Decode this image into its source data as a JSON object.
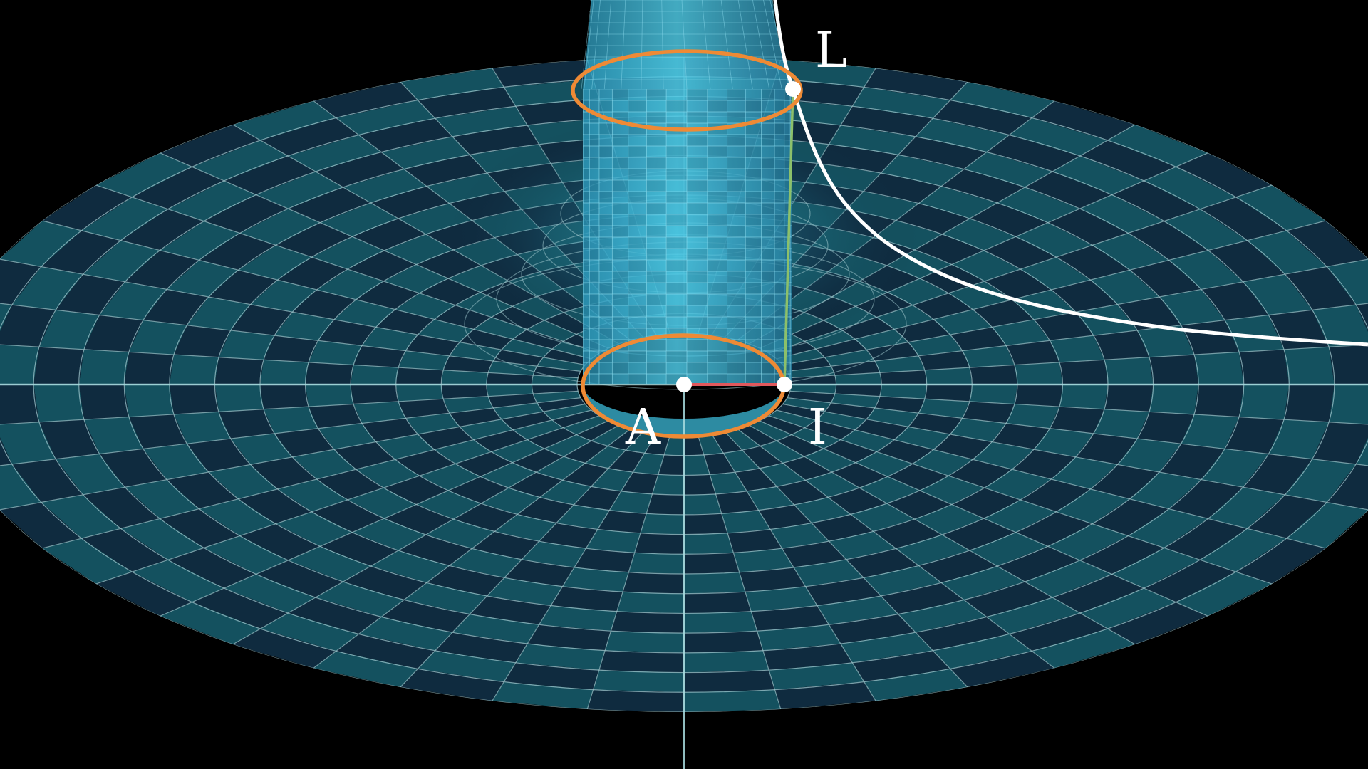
{
  "labels": {
    "top": "L",
    "bottom_left": "A",
    "bottom_right": "I"
  },
  "colors": {
    "background": "#000000",
    "disk_dark": "#0f2b3f",
    "disk_light": "#14515f",
    "grid_line": "#9fc6cc",
    "axis": "#a9dde0",
    "tube_light": "#3fc4df",
    "tube_dark": "#2a8fb0",
    "ring": "#ee8a35",
    "curve": "#ffffff",
    "radius_segment": "#e0585c",
    "vertical_segment": "#8cc06a",
    "point": "#ffffff"
  },
  "grid": {
    "rings": 14,
    "sectors": 48
  }
}
